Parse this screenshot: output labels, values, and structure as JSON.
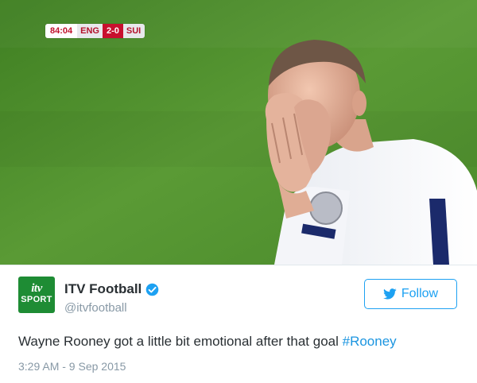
{
  "scoreboard": {
    "clock": "84:04",
    "home_team": "ENG",
    "score": "2-0",
    "away_team": "SUI"
  },
  "account": {
    "avatar_line1": "itv",
    "avatar_line2": "SPORT",
    "display_name": "ITV Football",
    "handle": "@itvfootball",
    "verified": true
  },
  "follow_button": {
    "label": "Follow",
    "icon": "twitter-bird-icon"
  },
  "tweet": {
    "text": "Wayne Rooney got a little bit emotional after that goal ",
    "hashtag": "#Rooney",
    "timestamp": "3:29 AM - 9 Sep 2015"
  },
  "colors": {
    "brand_blue": "#1da1f2",
    "hashtag_blue": "#1b95e0",
    "avatar_green": "#1e8c34",
    "pitch_green": "#4f8f2c",
    "text_dark": "#292f33",
    "text_muted": "#8899a6"
  }
}
